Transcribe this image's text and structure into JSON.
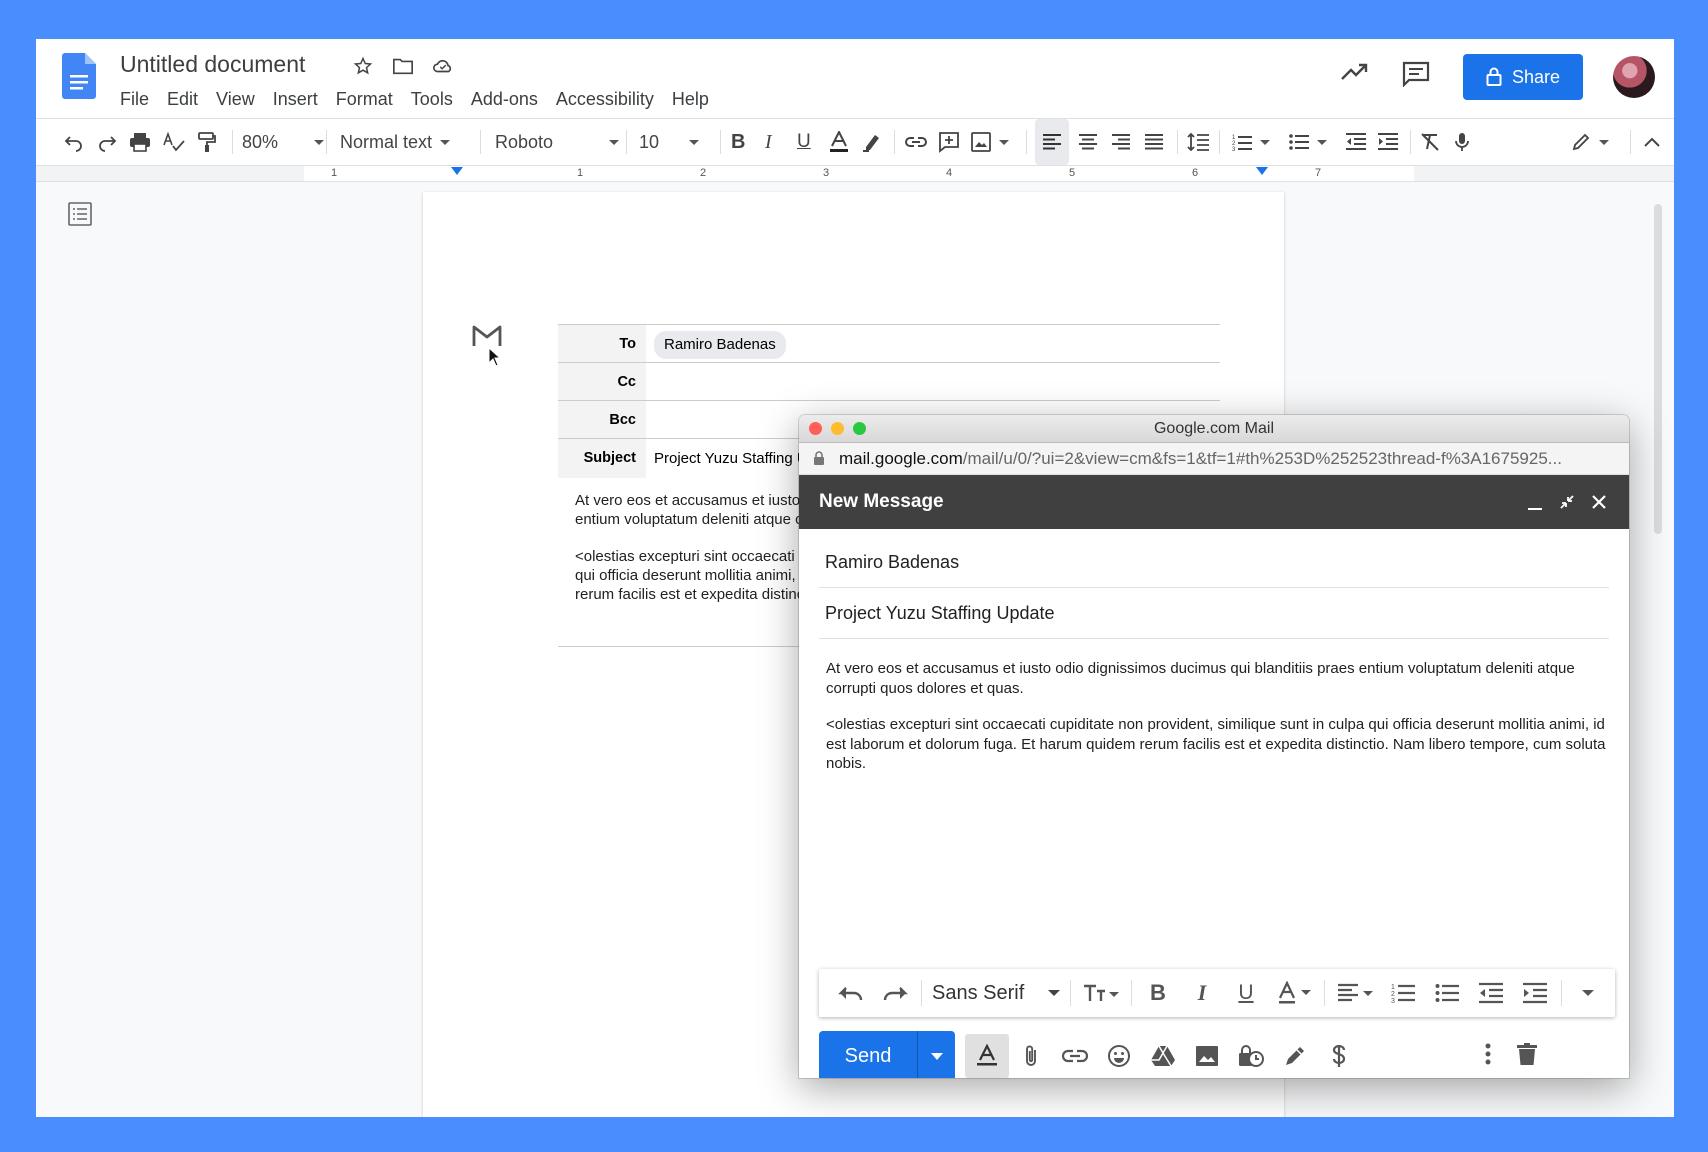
{
  "docs": {
    "title": "Untitled document",
    "menu": [
      "File",
      "Edit",
      "View",
      "Insert",
      "Format",
      "Tools",
      "Add-ons",
      "Accessibility",
      "Help"
    ],
    "share_label": "Share",
    "toolbar": {
      "zoom": "80%",
      "style": "Normal text",
      "font": "Roboto",
      "size": "10"
    },
    "ruler_numbers": [
      "1",
      "1",
      "2",
      "3",
      "4",
      "5",
      "6",
      "7"
    ]
  },
  "draft": {
    "labels": {
      "to": "To",
      "cc": "Cc",
      "bcc": "Bcc",
      "subject": "Subject"
    },
    "to_value": "Ramiro Badenas",
    "subject_value": "Project Yuzu Staffing Upd",
    "body_p1_l1": "At vero eos et accusamus et iusto oc",
    "body_p1_l2": "entium voluptatum deleniti atque cor",
    "body_p2_l1": "<olestias excepturi sint occaecati cu",
    "body_p2_l2": "qui officia deserunt mollitia animi, id",
    "body_p2_l3": "rerum facilis est et expedita distincti"
  },
  "popup": {
    "window_title": "Google.com Mail",
    "url_host": "mail.google.com",
    "url_path": "/mail/u/0/?ui=2&view=cm&fs=1&tf=1#th%253D%252523thread-f%3A1675925...",
    "compose_title": "New Message",
    "to": "Ramiro Badenas",
    "subject": "Project Yuzu Staffing Update",
    "body_p1": "At vero eos et accusamus et iusto odio dignissimos ducimus qui blanditiis praes entium voluptatum deleniti atque corrupti quos dolores et quas.",
    "body_p2": "<olestias excepturi sint occaecati cupiditate non provident, similique sunt in culpa qui officia deserunt mollitia animi, id est laborum et dolorum fuga. Et harum quidem rerum facilis est et expedita distinctio. Nam libero tempore, cum soluta nobis.",
    "font_family": "Sans Serif",
    "send_label": "Send"
  },
  "colors": {
    "background": "#4a8dfc",
    "accent": "#1a73e8",
    "compose_header": "#404040"
  }
}
